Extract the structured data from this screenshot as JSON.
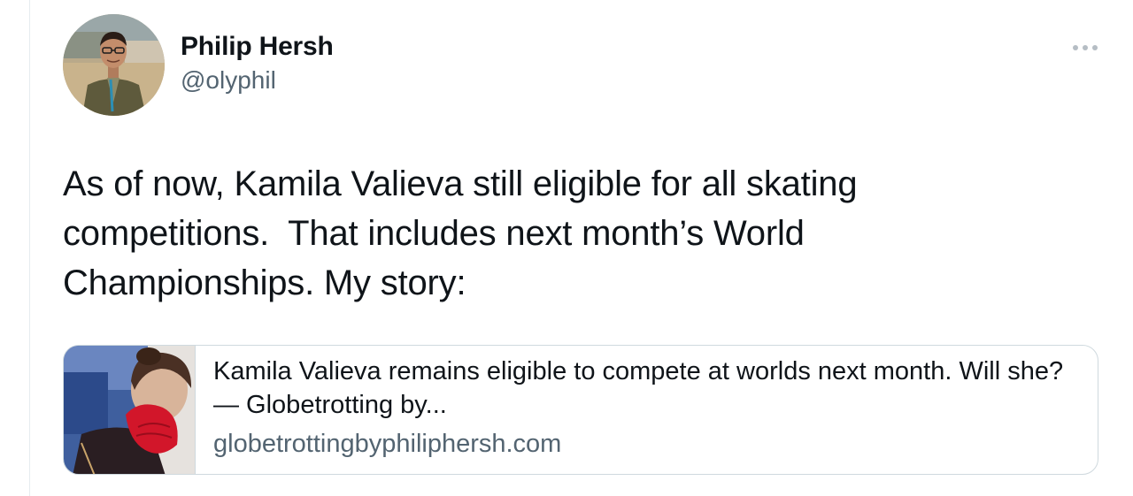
{
  "tweet": {
    "author": {
      "display_name": "Philip Hersh",
      "handle": "@olyphil"
    },
    "more_icon": "ellipsis-icon",
    "text": "As of now, Kamila Valieva still eligible for all skating\ncompetitions.  That includes next month’s World\nChampionships. My story:",
    "link_card": {
      "title": "Kamila Valieva remains eligible to compete at worlds next month. Will she? — Globetrotting by...",
      "domain": "globetrottingbyphiliphersh.com"
    }
  },
  "colors": {
    "text_primary": "#0f1419",
    "text_secondary": "#536471",
    "border": "#cfd9de"
  }
}
